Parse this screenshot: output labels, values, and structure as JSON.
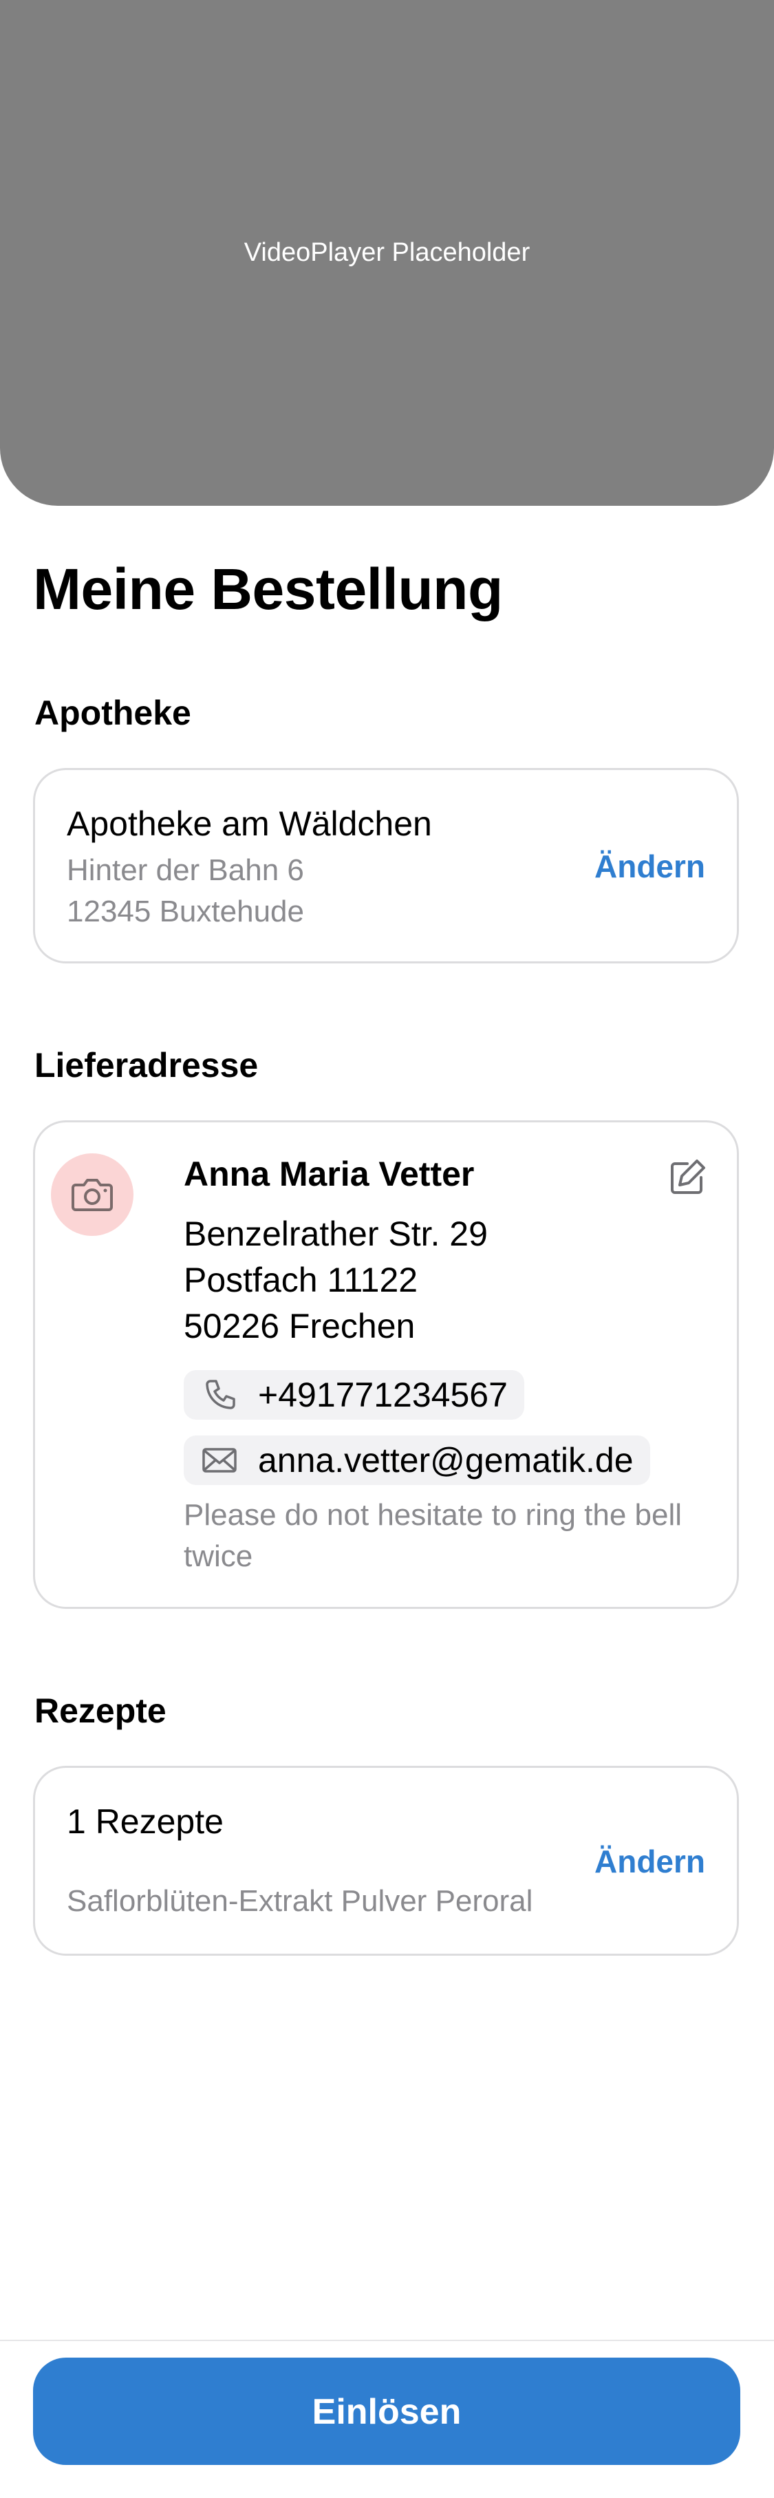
{
  "video": {
    "placeholder_text": "VideoPlayer Placeholder"
  },
  "page_title": "Meine Bestellung",
  "pharmacy": {
    "section_title": "Apotheke",
    "name": "Apotheke am Wäldchen",
    "street": "Hinter der Bahn 6",
    "city": "12345 Buxtehude",
    "change_label": "Ändern"
  },
  "delivery": {
    "section_title": "Lieferadresse",
    "name": "Anna Maria Vetter",
    "street": "Benzelrather Str. 29",
    "po_box": "Postfach 11122",
    "city": "50226  Frechen",
    "phone": "+491771234567",
    "email": "anna.vetter@gematik.de",
    "note": "Please do not hesitate to ring the bell twice",
    "avatar_icon": "camera-icon",
    "edit_icon": "edit-icon"
  },
  "prescriptions": {
    "section_title": "Rezepte",
    "count_label": "1 Rezepte",
    "item": "Saflorblüten-Extrakt Pulver Peroral",
    "change_label": "Ändern"
  },
  "submit_button": {
    "label": "Einlösen"
  },
  "colors": {
    "accent": "#2f7ed0",
    "video_bg": "#808080",
    "avatar_bg": "#fbd5d5",
    "secondary_text": "#8a8a8e",
    "card_border": "#dcdcde"
  }
}
